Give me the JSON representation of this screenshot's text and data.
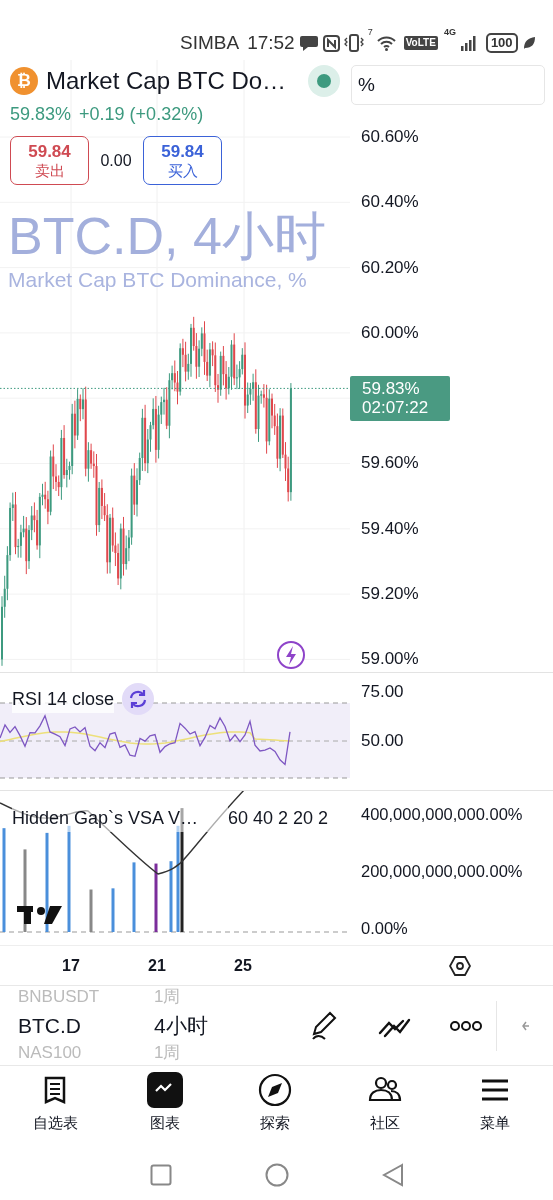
{
  "status_bar": {
    "carrier": "SIMBA",
    "time": "17:52",
    "wifi_standard": "7",
    "volte": "VoLTE",
    "network": "4G",
    "battery": "100"
  },
  "symbol": {
    "coin_glyph": "₿",
    "title": "Market Cap BTC Do…",
    "market_open": true,
    "price": "59.83%",
    "change": "+0.19 (+0.32%)",
    "sell": {
      "price": "59.84",
      "label": "卖出"
    },
    "spread": "0.00",
    "buy": {
      "price": "59.84",
      "label": "买入"
    }
  },
  "watermark": {
    "line_1": "BTC.D, 4小时",
    "line_2": "Market Cap BTC Dominance, %"
  },
  "price_axis": {
    "unit": "%",
    "rows": [
      {
        "kind": "tick",
        "label": "60.60%"
      },
      {
        "kind": "tick",
        "label": "60.40%"
      },
      {
        "kind": "tick",
        "label": "60.20%"
      },
      {
        "kind": "tick",
        "label": "60.00%"
      },
      {
        "kind": "last_price",
        "price": "59.83%",
        "countdown": "02:07:22"
      },
      {
        "kind": "tick",
        "label": "59.60%"
      },
      {
        "kind": "tick",
        "label": "59.40%"
      },
      {
        "kind": "tick",
        "label": "59.20%"
      },
      {
        "kind": "tick",
        "label": "59.00%"
      }
    ]
  },
  "rsi": {
    "title": "RSI 14 close",
    "ticks": [
      "75.00",
      "50.00"
    ]
  },
  "vsa": {
    "title": "Hidden Gap`s VSA V…",
    "inputs": "60 40 2 20 2",
    "ticks": [
      "400,000,000,000.00%",
      "200,000,000,000.00%",
      "0.00%"
    ]
  },
  "time_axis": [
    "17",
    "21",
    "25"
  ],
  "picker": [
    {
      "symbol": "BNBUSDT",
      "interval": "1周",
      "selected": false
    },
    {
      "symbol": "BTC.D",
      "interval": "4小时",
      "selected": true
    },
    {
      "symbol": "NAS100",
      "interval": "1周",
      "selected": false
    }
  ],
  "nav": [
    {
      "label": "自选表",
      "kind": "watchlist",
      "selected": false
    },
    {
      "label": "图表",
      "kind": "chart",
      "selected": true
    },
    {
      "label": "探索",
      "kind": "explore",
      "selected": false
    },
    {
      "label": "社区",
      "kind": "community",
      "selected": false
    },
    {
      "label": "菜单",
      "kind": "menu",
      "selected": false
    }
  ]
}
